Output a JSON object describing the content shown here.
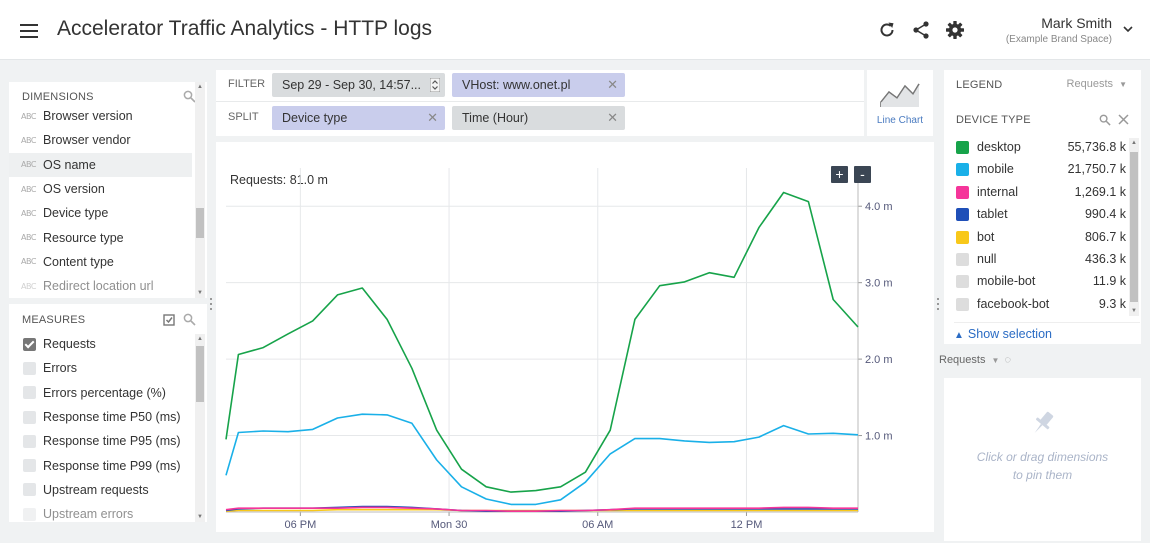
{
  "header": {
    "title": "Accelerator Traffic Analytics - HTTP logs",
    "user_name": "Mark Smith",
    "user_space": "(Example Brand Space)",
    "icons": [
      "refresh-icon",
      "share-icon",
      "gear-icon",
      "chevron-down-icon"
    ]
  },
  "dimensions": {
    "title": "DIMENSIONS",
    "items": [
      {
        "label": "Browser version"
      },
      {
        "label": "Browser vendor"
      },
      {
        "label": "OS name"
      },
      {
        "label": "OS version"
      },
      {
        "label": "Device type"
      },
      {
        "label": "Resource type"
      },
      {
        "label": "Content type"
      },
      {
        "label": "Redirect location url"
      }
    ],
    "selected": "OS name",
    "type_badge": "ABC"
  },
  "measures": {
    "title": "MEASURES",
    "items": [
      {
        "label": "Requests",
        "checked": true
      },
      {
        "label": "Errors",
        "checked": false
      },
      {
        "label": "Errors percentage (%)",
        "checked": false
      },
      {
        "label": "Response time P50 (ms)",
        "checked": false
      },
      {
        "label": "Response time P95 (ms)",
        "checked": false
      },
      {
        "label": "Response time P99 (ms)",
        "checked": false
      },
      {
        "label": "Upstream requests",
        "checked": false
      },
      {
        "label": "Upstream errors",
        "checked": false
      }
    ]
  },
  "filter": {
    "label": "FILTER",
    "time_pill": "Sep 29 - Sep 30, 14:57...",
    "vhost_pill": "VHost: www.onet.pl"
  },
  "split": {
    "label": "SPLIT",
    "pill1": "Device type",
    "pill2": "Time (Hour)"
  },
  "visualization": {
    "label": "Line Chart"
  },
  "chart": {
    "title": "Requests: 81.0 m",
    "zoom_in": "+",
    "zoom_out": "-"
  },
  "legend": {
    "title": "LEGEND",
    "measure": "Requests",
    "sub_title": "DEVICE TYPE",
    "show_selection": "Show selection",
    "rows": [
      {
        "name": "desktop",
        "value": "55,736.8 k",
        "color": "#17a34a"
      },
      {
        "name": "mobile",
        "value": "21,750.7 k",
        "color": "#1ab0e8"
      },
      {
        "name": "internal",
        "value": "1,269.1 k",
        "color": "#f5359a"
      },
      {
        "name": "tablet",
        "value": "990.4 k",
        "color": "#1f4fb8"
      },
      {
        "name": "bot",
        "value": "806.7 k",
        "color": "#f8c81a"
      },
      {
        "name": "null",
        "value": "436.3 k",
        "color": "#dddddd"
      },
      {
        "name": "mobile-bot",
        "value": "11.9 k",
        "color": "#dddddd"
      },
      {
        "name": "facebook-bot",
        "value": "9.3 k",
        "color": "#dddddd"
      }
    ]
  },
  "pin": {
    "measure": "Requests",
    "hint_line1": "Click or drag dimensions",
    "hint_line2": "to pin them"
  },
  "chart_data": {
    "type": "line",
    "title": "Requests: 81.0 m",
    "y_unit": "m",
    "ylim": [
      0,
      4.5
    ],
    "y_ticks": [
      "1.0 m",
      "2.0 m",
      "3.0 m",
      "4.0 m"
    ],
    "y_tick_values": [
      1.0,
      2.0,
      3.0,
      4.0
    ],
    "x_ticks": [
      "06 PM",
      "Mon 30",
      "06 AM",
      "12 PM"
    ],
    "x_tick_hours": [
      3,
      9,
      15,
      21
    ],
    "x_hours": [
      0,
      0.5,
      1.5,
      2.5,
      3.5,
      4.5,
      5.5,
      6.5,
      7.5,
      8.5,
      9.5,
      10.5,
      11.5,
      12.5,
      13.5,
      14.5,
      15.5,
      16.5,
      17.5,
      18.5,
      19.5,
      20.5,
      21.5,
      22.5,
      23.5,
      24.5,
      25.5
    ],
    "grid": true,
    "series": [
      {
        "name": "desktop",
        "color": "#17a34a",
        "values": [
          0.95,
          2.06,
          2.15,
          2.33,
          2.5,
          2.84,
          2.93,
          2.52,
          1.88,
          1.07,
          0.56,
          0.33,
          0.26,
          0.28,
          0.33,
          0.52,
          1.07,
          2.52,
          2.96,
          3.01,
          3.13,
          3.07,
          3.72,
          4.18,
          4.06,
          2.78,
          2.42
        ]
      },
      {
        "name": "mobile",
        "color": "#1ab0e8",
        "values": [
          0.48,
          1.04,
          1.06,
          1.05,
          1.08,
          1.23,
          1.28,
          1.27,
          1.16,
          0.68,
          0.33,
          0.17,
          0.1,
          0.1,
          0.16,
          0.39,
          0.76,
          0.96,
          0.96,
          0.93,
          0.91,
          0.92,
          0.98,
          1.13,
          1.02,
          1.03,
          1.01
        ]
      },
      {
        "name": "internal",
        "color": "#f5359a",
        "values": [
          0.03,
          0.05,
          0.05,
          0.05,
          0.05,
          0.05,
          0.06,
          0.06,
          0.05,
          0.04,
          0.02,
          0.02,
          0.01,
          0.01,
          0.02,
          0.02,
          0.03,
          0.05,
          0.05,
          0.05,
          0.05,
          0.05,
          0.05,
          0.06,
          0.06,
          0.05,
          0.05
        ]
      },
      {
        "name": "tablet",
        "color": "#1f4fb8",
        "values": [
          0.02,
          0.04,
          0.05,
          0.05,
          0.05,
          0.06,
          0.07,
          0.07,
          0.06,
          0.04,
          0.02,
          0.01,
          0.01,
          0.01,
          0.01,
          0.02,
          0.03,
          0.04,
          0.04,
          0.04,
          0.04,
          0.04,
          0.04,
          0.04,
          0.04,
          0.04,
          0.04
        ]
      },
      {
        "name": "bot",
        "color": "#f8c81a",
        "values": [
          0.01,
          0.02,
          0.02,
          0.02,
          0.02,
          0.03,
          0.03,
          0.03,
          0.03,
          0.03,
          0.02,
          0.02,
          0.02,
          0.02,
          0.02,
          0.02,
          0.02,
          0.02,
          0.02,
          0.02,
          0.02,
          0.02,
          0.02,
          0.02,
          0.02,
          0.02,
          0.02
        ]
      }
    ]
  }
}
